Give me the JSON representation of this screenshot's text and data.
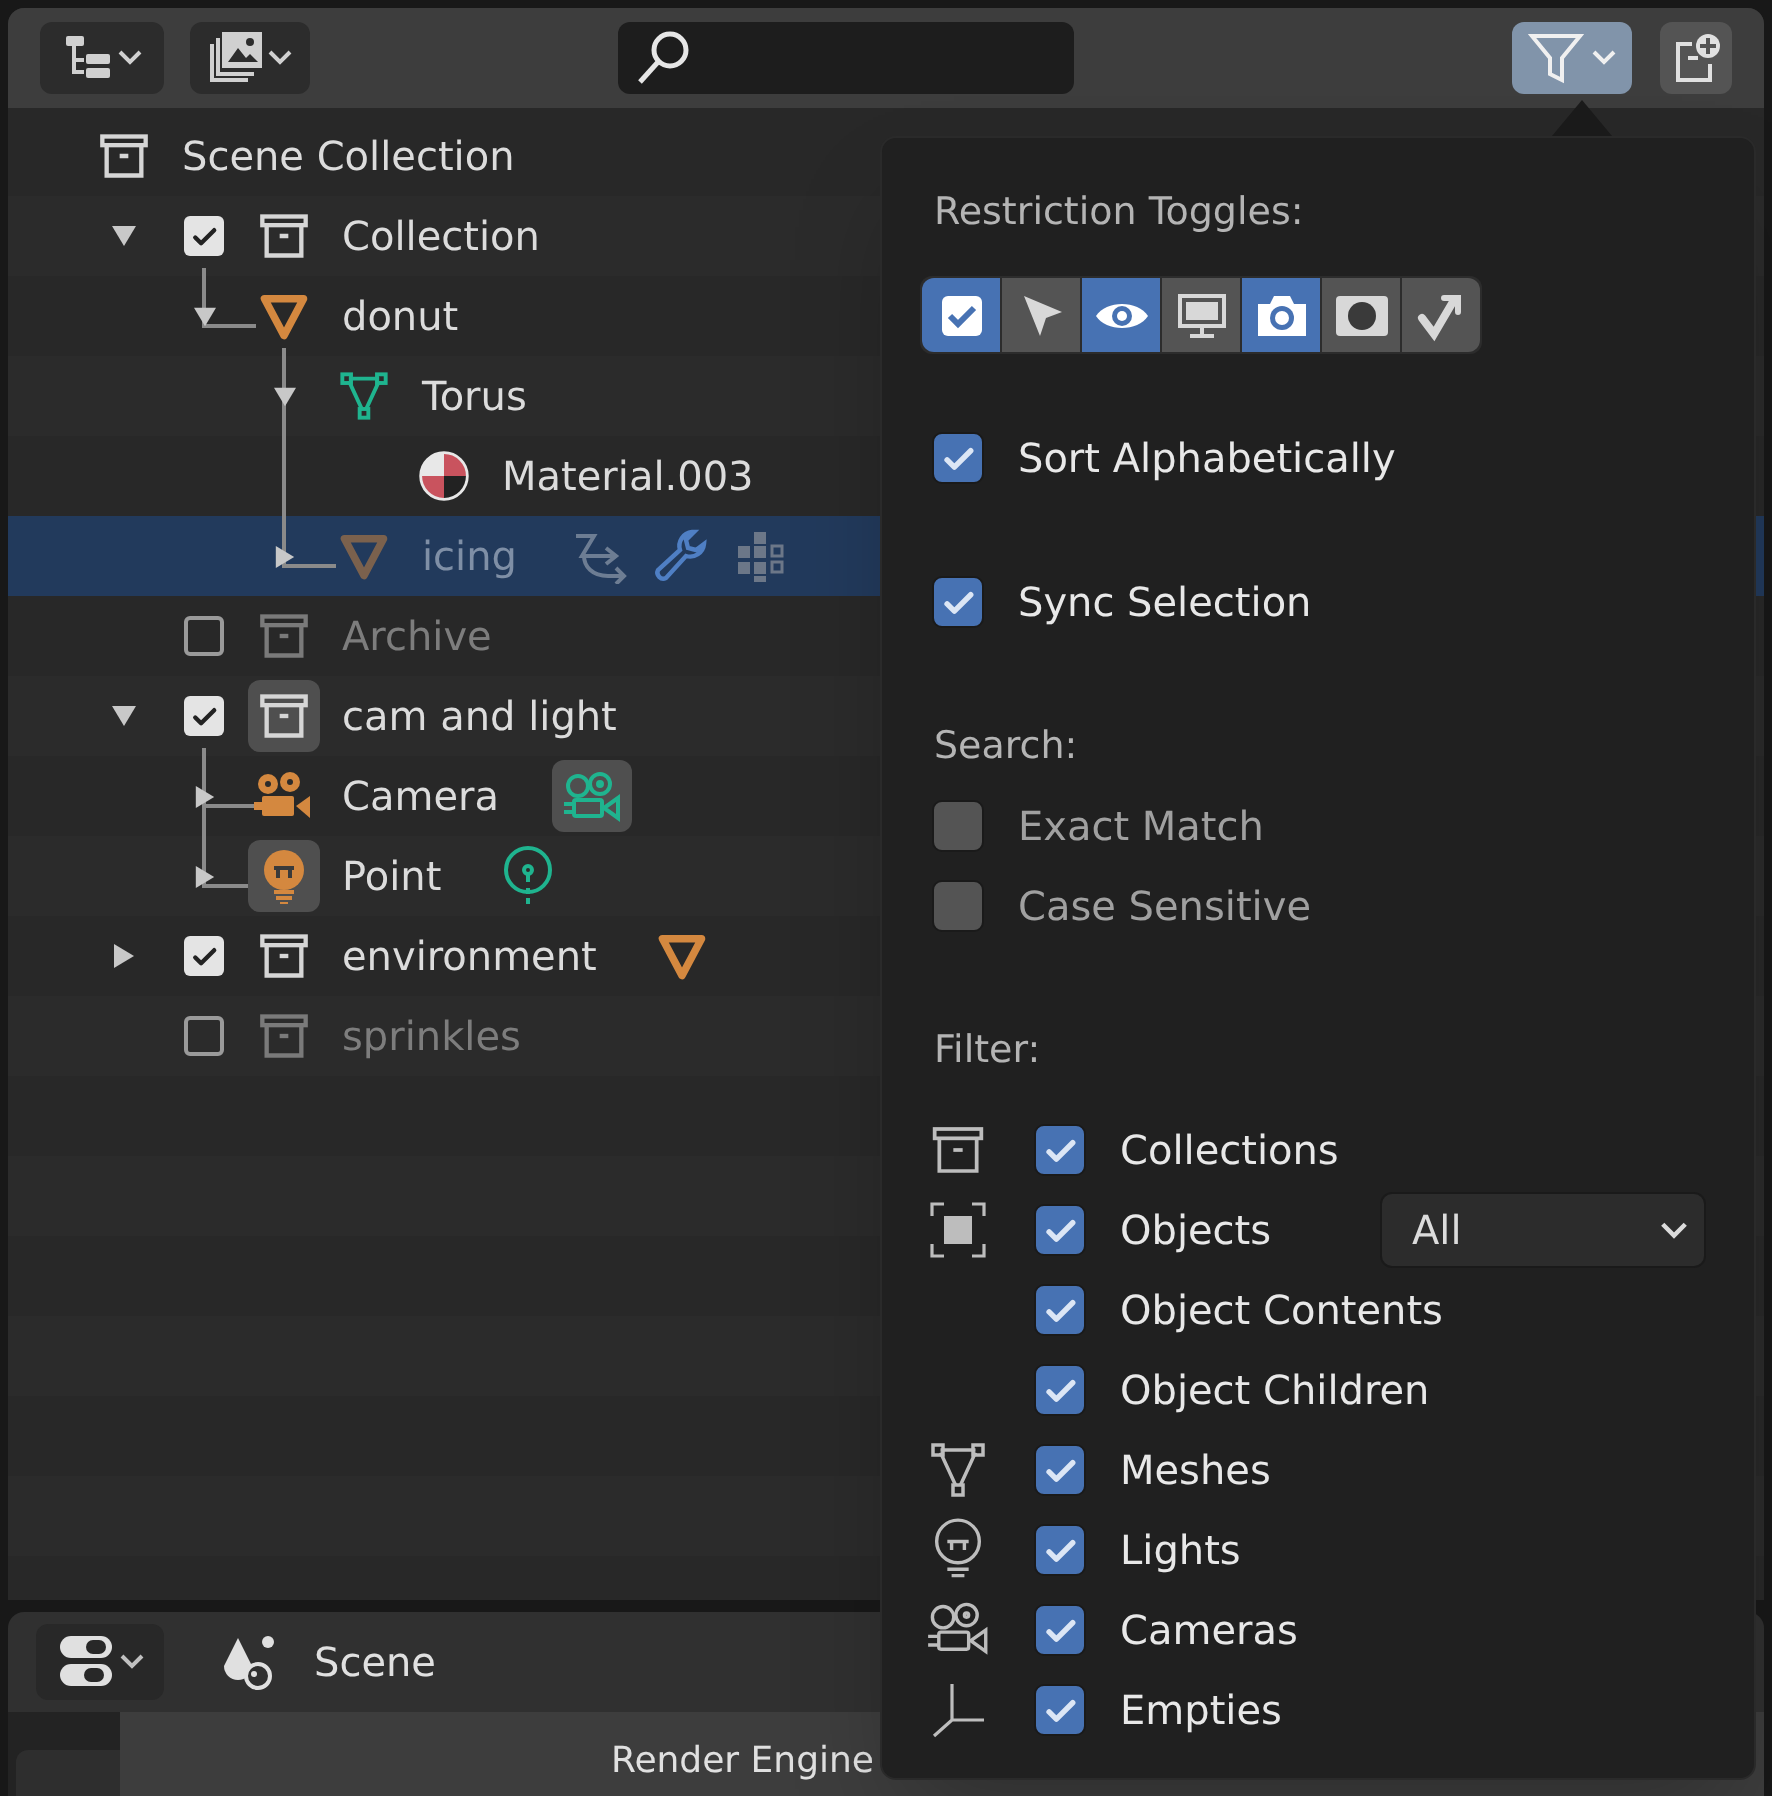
{
  "header": {
    "filter_button": {
      "active": true
    }
  },
  "tree": [
    {
      "name": "Scene Collection",
      "kind": "scene_collection",
      "children": [
        {
          "name": "Collection",
          "kind": "collection",
          "expanded": true,
          "checked": true,
          "children": [
            {
              "name": "donut",
              "kind": "object",
              "expanded": true,
              "children": [
                {
                  "name": "Torus",
                  "kind": "mesh",
                  "expanded": true,
                  "children": [
                    {
                      "name": "Material.003",
                      "kind": "material"
                    }
                  ]
                },
                {
                  "name": "icing",
                  "kind": "object",
                  "expanded": false,
                  "selected": true,
                  "hidden": true,
                  "extras": [
                    {
                      "kind": "constraint"
                    },
                    {
                      "kind": "modifier"
                    },
                    {
                      "kind": "particles"
                    }
                  ]
                }
              ]
            }
          ]
        },
        {
          "name": "Archive",
          "kind": "collection",
          "checked": false
        },
        {
          "name": "cam and light",
          "kind": "collection",
          "expanded": true,
          "checked": true,
          "active": true,
          "children": [
            {
              "name": "Camera",
              "kind": "camera",
              "expanded": false,
              "extras": [
                {
                  "kind": "camera_data",
                  "active": true
                }
              ]
            },
            {
              "name": "Point",
              "kind": "light",
              "expanded": false,
              "active": true,
              "extras": [
                {
                  "kind": "light_data"
                }
              ]
            }
          ]
        },
        {
          "name": "environment",
          "kind": "collection",
          "expanded": false,
          "checked": true,
          "extras": [
            {
              "kind": "object"
            }
          ]
        },
        {
          "name": "sprinkles",
          "kind": "collection",
          "checked": false
        }
      ]
    }
  ],
  "popup": {
    "restriction_toggles": {
      "title": "Restriction Toggles:",
      "toggles": [
        {
          "kind": "checkbox",
          "selected": true
        },
        {
          "kind": "select",
          "selected": false
        },
        {
          "kind": "eye",
          "selected": true
        },
        {
          "kind": "viewport",
          "selected": false
        },
        {
          "kind": "render",
          "selected": true
        },
        {
          "kind": "holdout",
          "selected": false
        },
        {
          "kind": "indirect",
          "selected": false
        }
      ]
    },
    "options": [
      {
        "label": "Sort Alphabetically",
        "checked": true
      },
      {
        "label": "Sync Selection",
        "checked": true
      }
    ],
    "search": {
      "title": "Search:",
      "options": [
        {
          "label": "Exact Match",
          "checked": false
        },
        {
          "label": "Case Sensitive",
          "checked": false
        }
      ]
    },
    "filter": {
      "title": "Filter:",
      "items": [
        {
          "label": "Collections",
          "kind": "collection",
          "checked": true
        },
        {
          "label": "Objects",
          "kind": "objects",
          "checked": true,
          "dropdown": "All"
        },
        {
          "label": "Object Contents",
          "checked": true
        },
        {
          "label": "Object Children",
          "checked": true
        },
        {
          "label": "Meshes",
          "kind": "mesh",
          "checked": true
        },
        {
          "label": "Lights",
          "kind": "light",
          "checked": true
        },
        {
          "label": "Cameras",
          "kind": "camera",
          "checked": true
        },
        {
          "label": "Empties",
          "kind": "empty",
          "checked": true
        }
      ]
    }
  },
  "properties": {
    "context": "Scene",
    "render_engine_label": "Render Engine"
  }
}
